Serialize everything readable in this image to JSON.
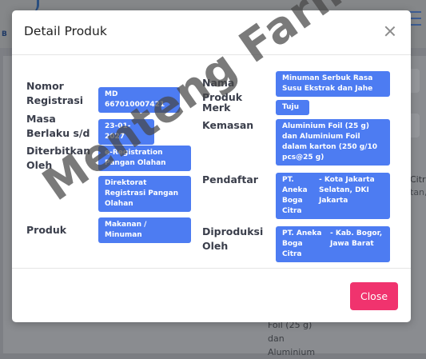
{
  "background": {
    "right_texts": [
      "Citr",
      "tan,"
    ],
    "bottom_texts": [
      "Foil (25 g)",
      "dan",
      "Aluminium"
    ]
  },
  "modal": {
    "title": "Detail Produk",
    "close_label": "Close",
    "fields": {
      "nomor_registrasi": {
        "label": "Nomor Registrasi",
        "value": "MD 667010007421"
      },
      "masa_berlaku": {
        "label": "Masa Berlaku s/d",
        "value": "23-01-2027"
      },
      "diterbitkan_oleh": {
        "label": "Diterbitkan Oleh",
        "values": [
          "e-Registration Pangan Olahan",
          "Direktorat Registrasi Pangan Olahan"
        ]
      },
      "produk": {
        "label": "Produk",
        "value": "Makanan / Minuman"
      },
      "nama_produk": {
        "label": "Nama Produk",
        "value": "Minuman Serbuk Rasa Susu Ekstrak dan Jahe"
      },
      "merk": {
        "label": "Merk",
        "value": "Tuju"
      },
      "kemasan": {
        "label": "Kemasan",
        "value": "Aluminium Foil (25 g) dan Aluminium Foil dalam karton (250 g/10 pcs@25 g)"
      },
      "pendaftar": {
        "label": "Pendaftar",
        "name": "PT. Aneka Boga Citra",
        "location": "- Kota Jakarta Selatan, DKI Jakarta"
      },
      "diproduksi_oleh": {
        "label": "Diproduksi Oleh",
        "name": "PT. Aneka Boga Citra",
        "location": "- Kab. Bogor, Jawa Barat"
      }
    }
  },
  "watermark": "Menteng Farma",
  "colors": {
    "chip": "#4d7cf2",
    "close_button": "#f0336e"
  }
}
